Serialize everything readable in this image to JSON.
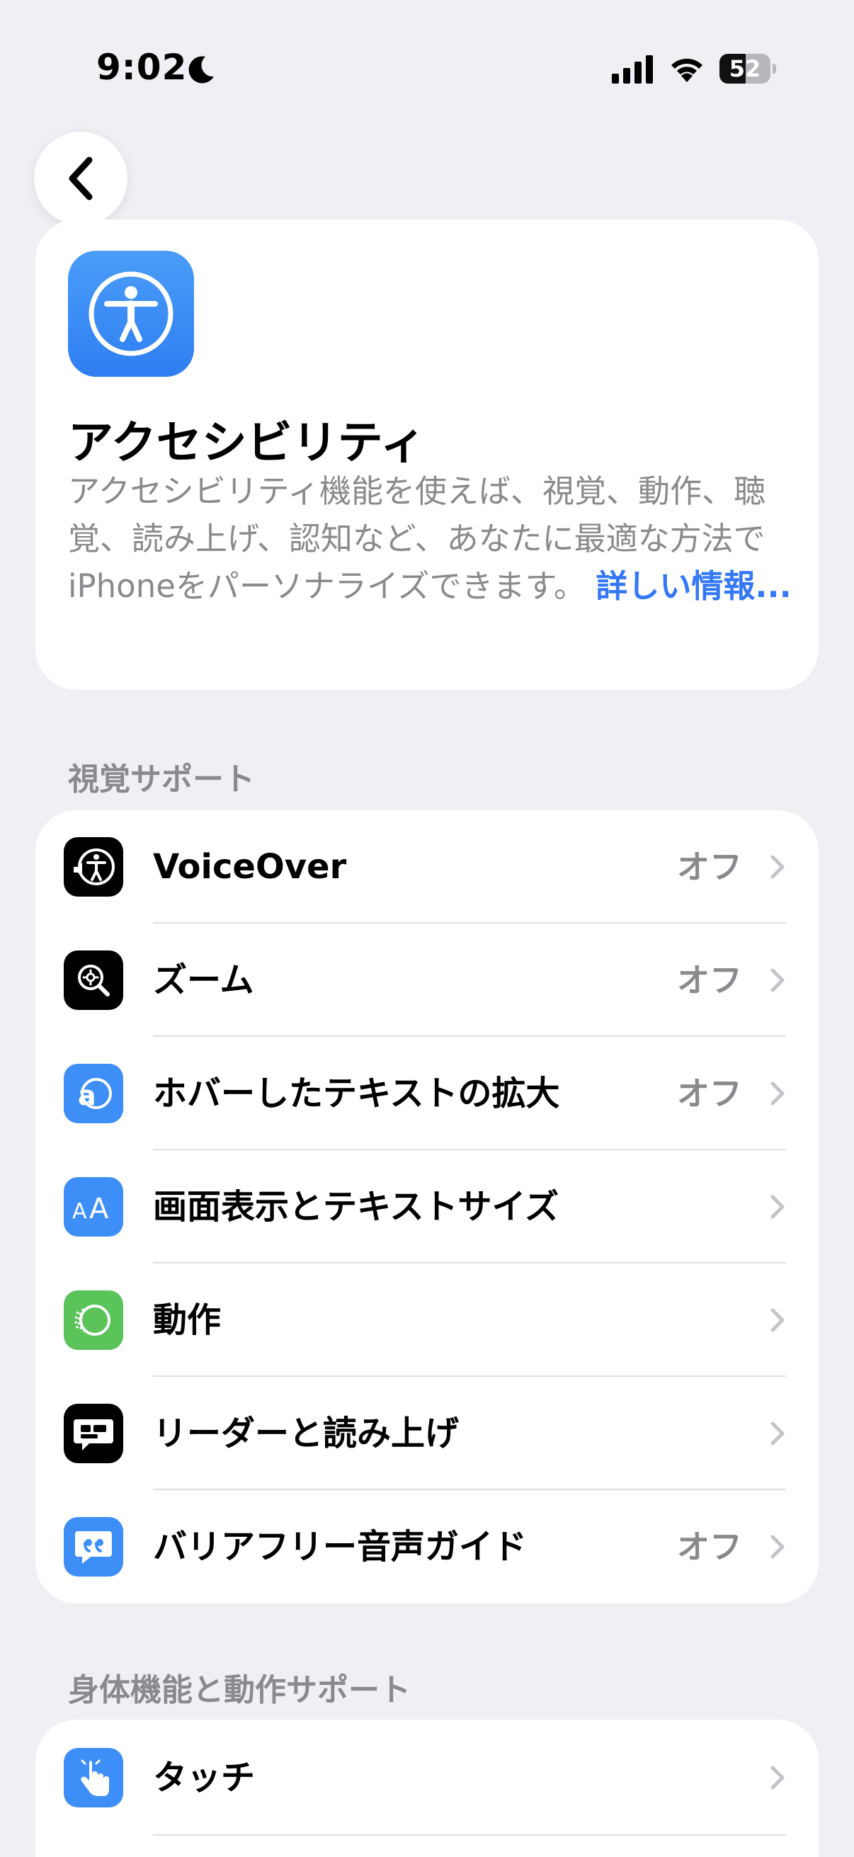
{
  "status_bar": {
    "time": "9:02",
    "battery_level": "52",
    "battery_fraction": 0.52
  },
  "navigation": {
    "back_icon": "chevron-left-icon"
  },
  "header": {
    "icon": "accessibility-icon",
    "title": "アクセシビリティ",
    "description": "アクセシビリティ機能を使えば、視覚、動作、聴覚、読み上げ、認知など、あなたに最適な方法でiPhoneをパーソナライズできます。",
    "learn_more": "詳しい情報..."
  },
  "sections": {
    "vision": {
      "title": "視覚サポート",
      "items": [
        {
          "label": "VoiceOver",
          "value": "オフ",
          "icon": "voiceover-icon"
        },
        {
          "label": "ズーム",
          "value": "オフ",
          "icon": "zoom-icon"
        },
        {
          "label": "ホバーしたテキストの拡大",
          "value": "オフ",
          "icon": "hover-text-icon"
        },
        {
          "label": "画面表示とテキストサイズ",
          "value": "",
          "icon": "text-size-icon"
        },
        {
          "label": "動作",
          "value": "",
          "icon": "motion-icon"
        },
        {
          "label": "リーダーと読み上げ",
          "value": "",
          "icon": "spoken-content-icon"
        },
        {
          "label": "バリアフリー音声ガイド",
          "value": "オフ",
          "icon": "audio-description-icon"
        }
      ]
    },
    "physical": {
      "title": "身体機能と動作サポート",
      "items": [
        {
          "label": "タッチ",
          "value": "",
          "icon": "touch-icon"
        }
      ]
    }
  },
  "colors": {
    "background": "#efeff4",
    "accent": "#3478f6",
    "secondary_text": "#8a8a8e",
    "blue_icon": "#3d8ef6",
    "green_icon": "#5ac35a",
    "black_icon": "#000000"
  }
}
